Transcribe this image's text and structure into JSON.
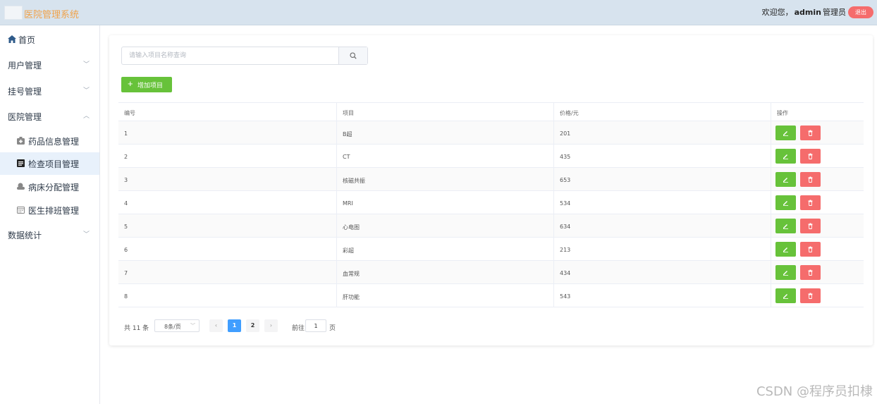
{
  "header": {
    "title": "医院管理系统",
    "welcome_prefix": "欢迎您，",
    "username": "admin",
    "role": "管理员",
    "logout_label": "退出"
  },
  "sidebar": {
    "home": "首页",
    "groups": [
      {
        "label": "用户管理",
        "expanded": false
      },
      {
        "label": "挂号管理",
        "expanded": false
      },
      {
        "label": "医院管理",
        "expanded": true
      },
      {
        "label": "数据统计",
        "expanded": false
      }
    ],
    "sub_items": [
      {
        "label": "药品信息管理",
        "icon": "medicine-box-icon",
        "active": false
      },
      {
        "label": "检查项目管理",
        "icon": "document-icon",
        "active": true
      },
      {
        "label": "病床分配管理",
        "icon": "bed-icon",
        "active": false
      },
      {
        "label": "医生排班管理",
        "icon": "calendar-icon",
        "active": false
      }
    ]
  },
  "search": {
    "placeholder": "请输入项目名称查询"
  },
  "toolbar": {
    "add_label": "增加项目"
  },
  "table": {
    "columns": [
      "编号",
      "项目",
      "价格/元",
      "操作"
    ],
    "rows": [
      {
        "id": "1",
        "name": "B超",
        "price": "201"
      },
      {
        "id": "2",
        "name": "CT",
        "price": "435"
      },
      {
        "id": "3",
        "name": "核磁共振",
        "price": "653"
      },
      {
        "id": "4",
        "name": "MRI",
        "price": "534"
      },
      {
        "id": "5",
        "name": "心电图",
        "price": "634"
      },
      {
        "id": "6",
        "name": "彩超",
        "price": "213"
      },
      {
        "id": "7",
        "name": "血常规",
        "price": "434"
      },
      {
        "id": "8",
        "name": "肝功能",
        "price": "543"
      }
    ]
  },
  "pagination": {
    "total_text": "共 11 条",
    "page_size": "8条/页",
    "pages": [
      "1",
      "2"
    ],
    "current_page": "1",
    "goto_prefix": "前往",
    "goto_value": "1",
    "goto_suffix": "页"
  },
  "watermark": "CSDN @程序员扣棣",
  "colors": {
    "accent_blue": "#409eff",
    "success_green": "#67c23a",
    "danger_red": "#f56c6c",
    "title_orange": "#f0a24a",
    "header_bg": "#d7e3ee"
  }
}
